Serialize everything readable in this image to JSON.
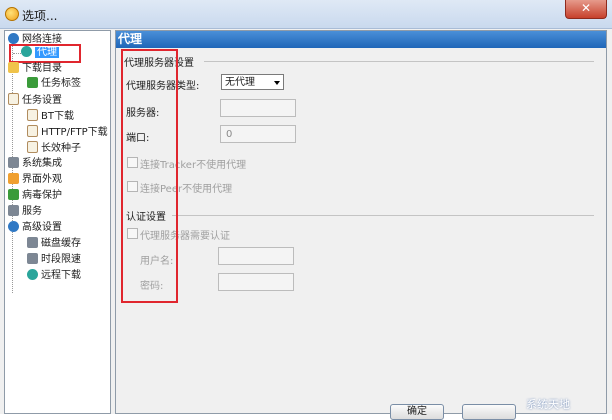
{
  "window": {
    "title": "选项..."
  },
  "tree": {
    "items": [
      {
        "label": "网络连接",
        "icon": "network-globe-icon"
      },
      {
        "label": "代理",
        "icon": "proxy-icon",
        "selected": true
      },
      {
        "label": "下载目录",
        "icon": "folder-icon"
      },
      {
        "label": "任务标签",
        "icon": "tag-icon"
      },
      {
        "label": "任务设置",
        "icon": "task-settings-icon"
      },
      {
        "label": "BT下载",
        "icon": "document-icon"
      },
      {
        "label": "HTTP/FTP下载",
        "icon": "document-icon"
      },
      {
        "label": "长效种子",
        "icon": "document-icon"
      },
      {
        "label": "系统集成",
        "icon": "system-icon"
      },
      {
        "label": "界面外观",
        "icon": "appearance-icon"
      },
      {
        "label": "病毒保护",
        "icon": "shield-icon"
      },
      {
        "label": "服务",
        "icon": "service-icon"
      },
      {
        "label": "高级设置",
        "icon": "advanced-settings-icon"
      },
      {
        "label": "磁盘缓存",
        "icon": "disk-cache-icon"
      },
      {
        "label": "时段限速",
        "icon": "speed-limit-icon"
      },
      {
        "label": "远程下载",
        "icon": "remote-download-icon"
      }
    ]
  },
  "panel": {
    "header": "代理",
    "proxy_group_title": "代理服务器设置",
    "proxy_type_label": "代理服务器类型:",
    "proxy_type_value": "无代理",
    "server_label": "服务器:",
    "server_value": "",
    "port_label": "端口:",
    "port_value": "0",
    "tracker_checkbox": "连接Tracker不使用代理",
    "peer_checkbox": "连接Peer不使用代理",
    "auth_group_title": "认证设置",
    "auth_checkbox": "代理服务器需要认证",
    "username_label": "用户名:",
    "username_value": "",
    "password_label": "密码:",
    "password_value": ""
  },
  "footer": {
    "ok_label": "确定",
    "watermark": "系统天地"
  },
  "colors": {
    "highlight": "#e0262e",
    "header_blue": "#1f66b8",
    "selection": "#3399ff"
  }
}
